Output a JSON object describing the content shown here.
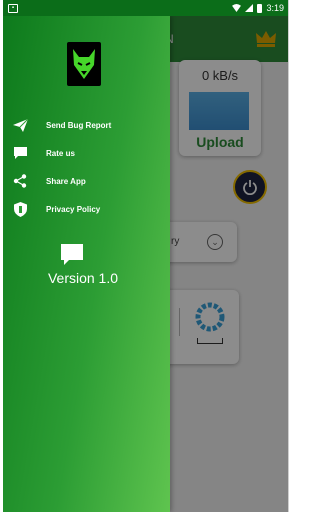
{
  "status_bar": {
    "time": "3:19",
    "icons": [
      "notification-icon",
      "wifi-icon",
      "signal-icon",
      "battery-icon"
    ]
  },
  "background_app": {
    "title_fragment": "N",
    "upload_speed": "0  kB/s",
    "upload_label": "Upload",
    "server_text_fragment": "ry",
    "colors": {
      "toolbar": "#2e8b3a",
      "accent": "#2e8b3a",
      "power": "#1e2340",
      "power_ring": "#f0c000"
    }
  },
  "drawer": {
    "logo_icon": "wolf-logo-icon",
    "menu": [
      {
        "label": "Send Bug Report",
        "icon": "send-icon"
      },
      {
        "label": "Rate us",
        "icon": "chat-bubble-icon"
      },
      {
        "label": "Share App",
        "icon": "share-icon"
      },
      {
        "label": "Privacy Policy",
        "icon": "shield-icon"
      }
    ],
    "version_icon": "chat-bubble-icon",
    "version": "Version 1.0",
    "colors": {
      "gradient_start": "#0d7a1c",
      "gradient_end": "#5fc44f",
      "text": "#ffffff"
    }
  }
}
